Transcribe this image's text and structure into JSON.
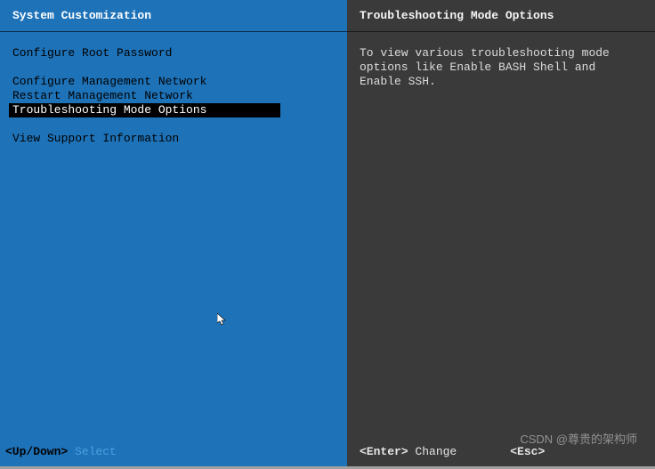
{
  "left": {
    "title": "System Customization",
    "menu": {
      "group1": [
        "Configure Root Password"
      ],
      "group2": [
        "Configure Management Network",
        "Restart Management Network",
        "Troubleshooting Mode Options"
      ],
      "group3": [
        "View Support Information"
      ]
    },
    "selected_item": "Troubleshooting Mode Options",
    "footer": {
      "key": "<Up/Down>",
      "action": "Select"
    }
  },
  "right": {
    "title": "Troubleshooting Mode Options",
    "description": "To view various troubleshooting mode options like Enable BASH Shell and Enable SSH.",
    "footer": {
      "hint1": {
        "key": "<Enter>",
        "action": "Change"
      },
      "hint2": {
        "key": "<Esc>",
        "action": ""
      }
    }
  },
  "watermark": "CSDN @尊贵的架构师"
}
